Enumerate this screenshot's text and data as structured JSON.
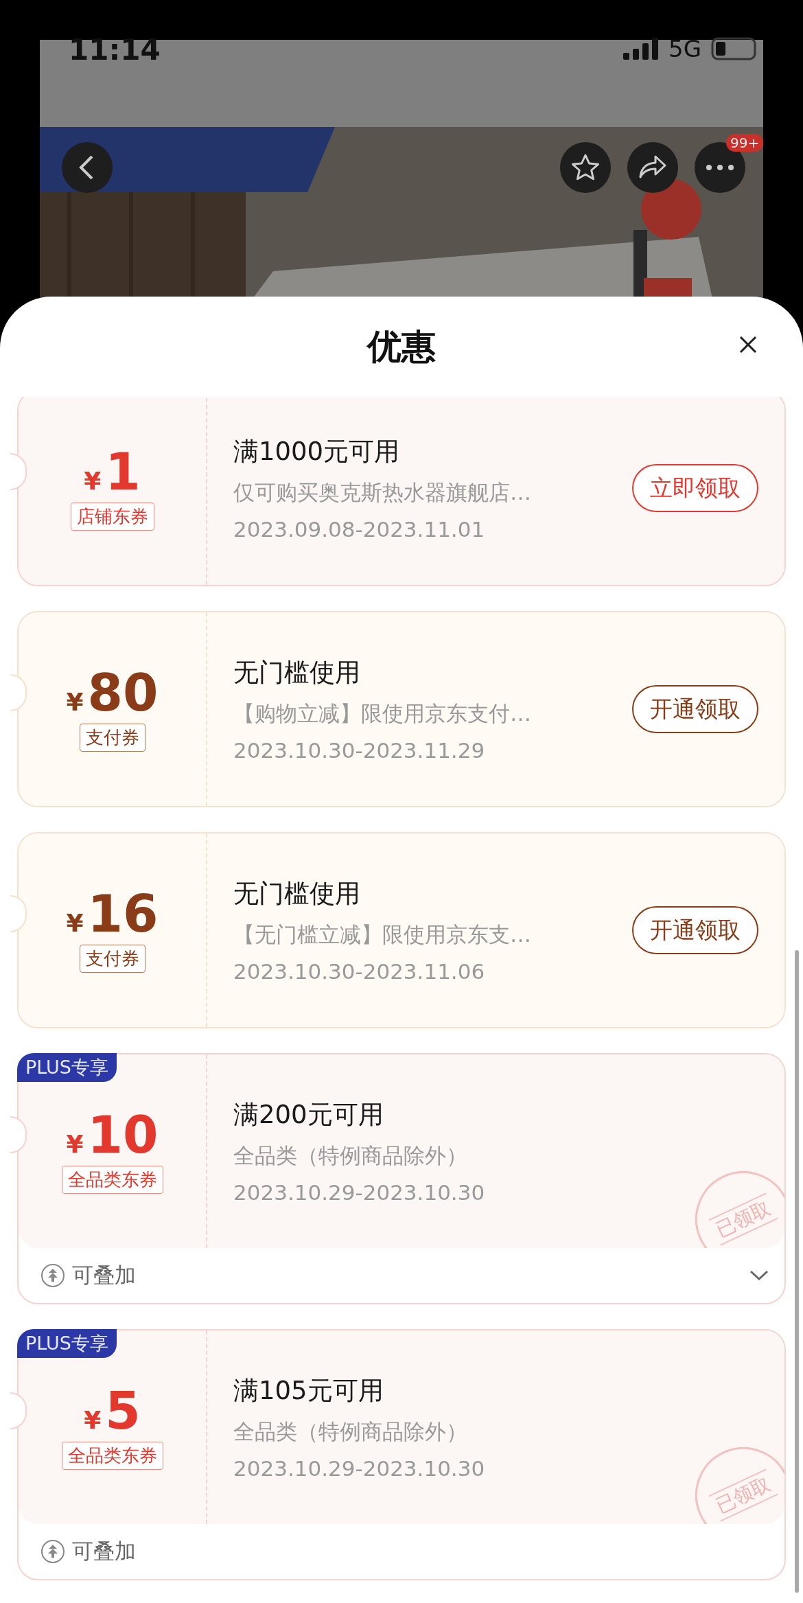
{
  "status_bar": {
    "time": "11:14",
    "network": "5G"
  },
  "banner": {
    "kind": "picture",
    "more_badge": "99+"
  },
  "sheet": {
    "title": "优惠"
  },
  "coupons": [
    {
      "kind": "store",
      "currency": "¥",
      "amount": "1",
      "tag": "店铺东券",
      "condition": "满1000元可用",
      "description": "仅可购买奥克斯热水器旗舰店…",
      "dates": "2023.09.08-2023.11.01",
      "button": "立即领取"
    },
    {
      "kind": "pay",
      "currency": "¥",
      "amount": "80",
      "tag": "支付券",
      "condition": "无门槛使用",
      "description": "【购物立减】限使用京东支付…",
      "dates": "2023.10.30-2023.11.29",
      "button": "开通领取"
    },
    {
      "kind": "pay",
      "currency": "¥",
      "amount": "16",
      "tag": "支付券",
      "condition": "无门槛使用",
      "description": "【无门槛立减】限使用京东支…",
      "dates": "2023.10.30-2023.11.06",
      "button": "开通领取"
    },
    {
      "kind": "store",
      "badge": "PLUS专享",
      "currency": "¥",
      "amount": "10",
      "tag": "全品类东券",
      "condition": "满200元可用",
      "description": "全品类（特例商品除外）",
      "dates": "2023.10.29-2023.10.30",
      "stamp": "已领取",
      "footer": "可叠加",
      "expandable": true
    },
    {
      "kind": "store",
      "badge": "PLUS专享",
      "currency": "¥",
      "amount": "5",
      "tag": "全品类东券",
      "condition": "满105元可用",
      "description": "全品类（特例商品除外）",
      "dates": "2023.10.29-2023.10.30",
      "stamp": "已领取",
      "footer": "可叠加",
      "expandable": false
    }
  ]
}
